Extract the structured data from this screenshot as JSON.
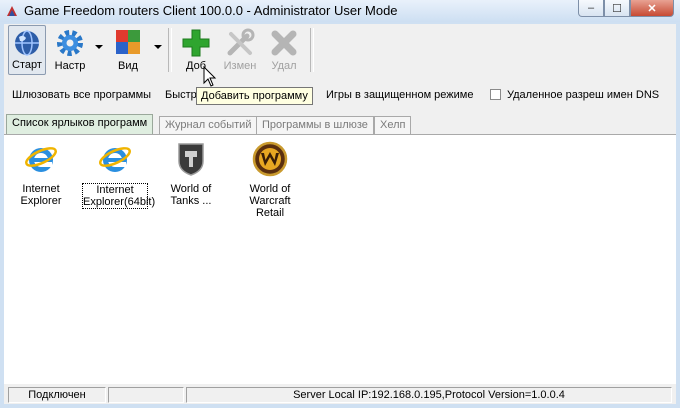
{
  "window": {
    "title": "Game Freedom routers Client 100.0.0 - Administrator User Mode",
    "minimize_glyph": "–",
    "maximize_glyph": "☐",
    "close_glyph": "✕"
  },
  "toolbar": {
    "start_label": "Старт",
    "settings_label": "Настр",
    "view_label": "Вид",
    "add_label": "Доб",
    "edit_label": "Измен",
    "delete_label": "Удал"
  },
  "options": {
    "proxy_all": "Шлюзовать все программы",
    "fast": "Быстр",
    "games_protected": "Игры в защищенном режиме",
    "remote_dns": "Удаленное разреш имен DNS"
  },
  "tooltip": "Добавить программу",
  "tabs": [
    {
      "label": "Список ярлыков программ",
      "active": true
    },
    {
      "label": "Журнал событий",
      "active": false
    },
    {
      "label": "Программы в шлюзе",
      "active": false
    },
    {
      "label": "Хелп",
      "active": false
    }
  ],
  "programs": [
    {
      "line1": "Internet",
      "line2": "Explorer",
      "icon": "internet-explorer-icon"
    },
    {
      "line1": "Internet",
      "line2": "Explorer(64bit)",
      "icon": "internet-explorer-icon",
      "selected": true
    },
    {
      "line1": "World of",
      "line2": "Tanks ...",
      "icon": "world-of-tanks-icon"
    },
    {
      "line1": "World of",
      "line2": "Warcraft Retail",
      "icon": "world-of-warcraft-icon"
    }
  ],
  "status": {
    "connection": "Подключен",
    "middle": "",
    "server_info": "Server Local IP:192.168.0.195,Protocol Version=1.0.0.4"
  },
  "colors": {
    "add_green": "#2fa52f",
    "active_tab": "#dfeee0",
    "tooltip_bg": "#ffffe1"
  }
}
